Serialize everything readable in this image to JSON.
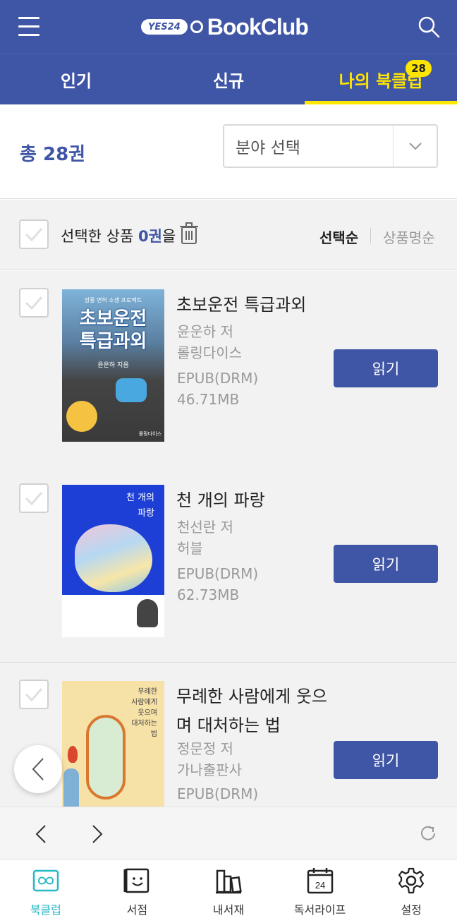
{
  "header": {
    "logo_badge": "YES24",
    "logo_text": "BookClub"
  },
  "tabs": [
    {
      "label": "인기"
    },
    {
      "label": "신규"
    },
    {
      "label": "나의 북클럽",
      "badge": "28"
    }
  ],
  "summary": {
    "total": "총 28권",
    "category_select": "분야 선택"
  },
  "selection": {
    "prefix": "선택한 상품 ",
    "count": "0권",
    "suffix": "을",
    "sort_selected": "선택순",
    "sort_other": "상품명순"
  },
  "books": [
    {
      "title": "초보운전 특급과외",
      "author": "윤운하 저",
      "publisher": "롤링다이스",
      "format": "EPUB(DRM)",
      "size": "46.71MB",
      "button": "읽기",
      "cover_text": [
        "초보운전",
        "특급과외"
      ],
      "cover_top": "장롱 면허 소생 프로젝트",
      "cover_author": "윤운하 지음",
      "cover_publisher": "롤링다이스"
    },
    {
      "title": "천 개의 파랑",
      "author": "천선란 저",
      "publisher": "허블",
      "format": "EPUB(DRM)",
      "size": "62.73MB",
      "button": "읽기",
      "cover_text": [
        "천 개의",
        "파랑"
      ]
    },
    {
      "title": "무례한 사람에게 웃으며 대처하는 법",
      "author": "정문정 저",
      "publisher": "가나출판사",
      "format": "EPUB(DRM)",
      "button": "읽기",
      "cover_text": [
        "무례한",
        "사람에게",
        "웃으며",
        "대처하는",
        "법"
      ]
    }
  ],
  "bottom_nav": [
    {
      "label": "북클럽",
      "icon": "bookclub-icon",
      "active": true
    },
    {
      "label": "서점",
      "icon": "store-icon"
    },
    {
      "label": "내서재",
      "icon": "library-icon"
    },
    {
      "label": "독서라이프",
      "icon": "calendar-icon",
      "icon_text": "24"
    },
    {
      "label": "설정",
      "icon": "gear-icon"
    }
  ],
  "colors": {
    "primary": "#3f55a5",
    "accent": "#ffe600",
    "active_nav": "#25b8c6"
  }
}
